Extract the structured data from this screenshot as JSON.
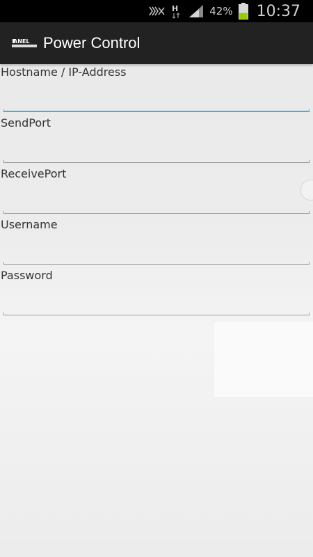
{
  "status_bar": {
    "icons": [
      "mute-icon",
      "h-data-icon",
      "signal-icon",
      "battery-icon"
    ],
    "network_type": "H",
    "battery_percent": "42%",
    "battery_level": 0.42,
    "time": "10:37"
  },
  "action_bar": {
    "logo_text": "ANEL",
    "title": "Power Control"
  },
  "form": {
    "fields": [
      {
        "label": "Hostname / IP-Address",
        "value": "",
        "focused": true
      },
      {
        "label": "SendPort",
        "value": ""
      },
      {
        "label": "ReceivePort",
        "value": ""
      },
      {
        "label": "Username",
        "value": ""
      },
      {
        "label": "Password",
        "value": ""
      }
    ]
  },
  "colors": {
    "focus_accent": "#33b5e5",
    "action_bar_bg": "#222222",
    "battery_fill": "#99cc00"
  }
}
